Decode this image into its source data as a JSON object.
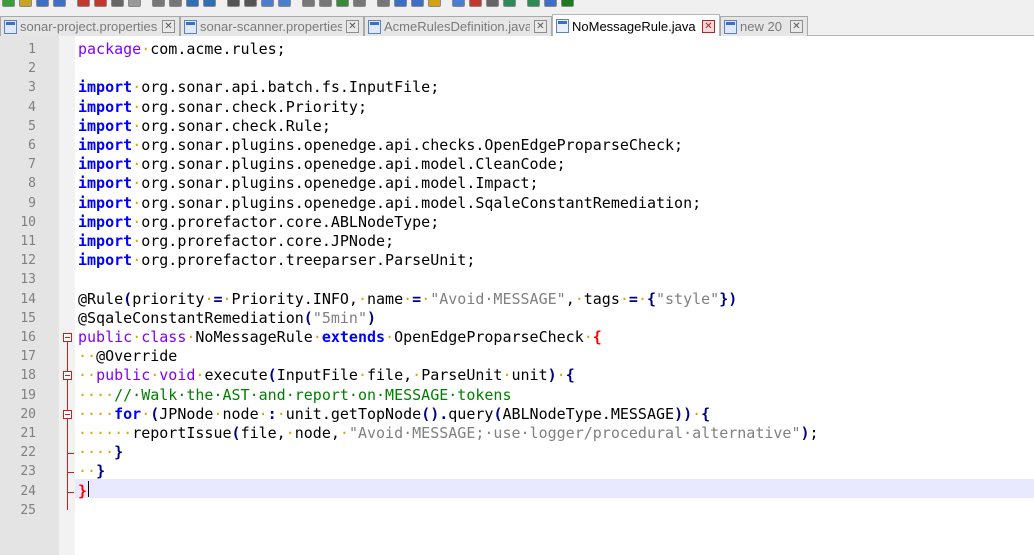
{
  "toolbar": {
    "icons": [
      "new-file-icon",
      "open-file-icon",
      "save-icon",
      "save-all-icon",
      "close-icon",
      "close-all-icon",
      "print-icon",
      "cut-icon",
      "copy-icon",
      "paste-icon",
      "undo-icon",
      "redo-icon",
      "find-icon",
      "replace-icon",
      "zoom-in-icon",
      "zoom-out-icon",
      "sync-icon",
      "wrap-icon",
      "indent-guide-icon",
      "show-all-chars-icon",
      "fold-all-icon",
      "doc-map-icon",
      "function-list-icon",
      "folder-icon",
      "monitor-icon",
      "record-macro-icon",
      "stop-macro-icon",
      "play-macro-icon",
      "run-macro-icon",
      "save-macro-icon",
      "spellcheck-icon"
    ]
  },
  "tabs": [
    {
      "label": "sonar-project.properties",
      "active": false
    },
    {
      "label": "sonar-scanner.properties",
      "active": false
    },
    {
      "label": "AcmeRulesDefinition.java",
      "active": false
    },
    {
      "label": "NoMessageRule.java",
      "active": true
    },
    {
      "label": "new 20",
      "active": false
    }
  ],
  "editor": {
    "line_numbers": [
      "1",
      "2",
      "3",
      "4",
      "5",
      "6",
      "7",
      "8",
      "9",
      "10",
      "11",
      "12",
      "13",
      "14",
      "15",
      "16",
      "17",
      "18",
      "19",
      "20",
      "21",
      "22",
      "23",
      "24",
      "25"
    ],
    "lines": [
      [
        [
          "kw2",
          "package"
        ],
        [
          "ws",
          "·"
        ],
        [
          "",
          "com.acme.rules;"
        ]
      ],
      [],
      [
        [
          "kw",
          "import"
        ],
        [
          "ws",
          "·"
        ],
        [
          "",
          "org.sonar.api.batch.fs.InputFile;"
        ]
      ],
      [
        [
          "kw",
          "import"
        ],
        [
          "ws",
          "·"
        ],
        [
          "",
          "org.sonar.check.Priority;"
        ]
      ],
      [
        [
          "kw",
          "import"
        ],
        [
          "ws",
          "·"
        ],
        [
          "",
          "org.sonar.check.Rule;"
        ]
      ],
      [
        [
          "kw",
          "import"
        ],
        [
          "ws",
          "·"
        ],
        [
          "",
          "org.sonar.plugins.openedge.api.checks.OpenEdgeProparseCheck;"
        ]
      ],
      [
        [
          "kw",
          "import"
        ],
        [
          "ws",
          "·"
        ],
        [
          "",
          "org.sonar.plugins.openedge.api.model.CleanCode;"
        ]
      ],
      [
        [
          "kw",
          "import"
        ],
        [
          "ws",
          "·"
        ],
        [
          "",
          "org.sonar.plugins.openedge.api.model.Impact;"
        ]
      ],
      [
        [
          "kw",
          "import"
        ],
        [
          "ws",
          "·"
        ],
        [
          "",
          "org.sonar.plugins.openedge.api.model.SqaleConstantRemediation;"
        ]
      ],
      [
        [
          "kw",
          "import"
        ],
        [
          "ws",
          "·"
        ],
        [
          "",
          "org.prorefactor.core.ABLNodeType;"
        ]
      ],
      [
        [
          "kw",
          "import"
        ],
        [
          "ws",
          "·"
        ],
        [
          "",
          "org.prorefactor.core.JPNode;"
        ]
      ],
      [
        [
          "kw",
          "import"
        ],
        [
          "ws",
          "·"
        ],
        [
          "",
          "org.prorefactor.treeparser.ParseUnit;"
        ]
      ],
      [],
      [
        [
          "",
          "@Rule"
        ],
        [
          "op",
          "("
        ],
        [
          "",
          "priority"
        ],
        [
          "ws",
          "·"
        ],
        [
          "op",
          "="
        ],
        [
          "ws",
          "·"
        ],
        [
          "",
          "Priority.INFO,"
        ],
        [
          "ws",
          "·"
        ],
        [
          "",
          "name"
        ],
        [
          "ws",
          "·"
        ],
        [
          "op",
          "="
        ],
        [
          "ws",
          "·"
        ],
        [
          "str",
          "\"Avoid·MESSAGE\""
        ],
        [
          "",
          ","
        ],
        [
          "ws",
          "·"
        ],
        [
          "",
          "tags"
        ],
        [
          "ws",
          "·"
        ],
        [
          "op",
          "="
        ],
        [
          "ws",
          "·"
        ],
        [
          "op",
          "{"
        ],
        [
          "str",
          "\"style\""
        ],
        [
          "op",
          "})"
        ]
      ],
      [
        [
          "",
          "@SqaleConstantRemediation"
        ],
        [
          "op",
          "("
        ],
        [
          "str",
          "\"5min\""
        ],
        [
          "op",
          ")"
        ]
      ],
      [
        [
          "kw2",
          "public"
        ],
        [
          "ws",
          "·"
        ],
        [
          "kw2",
          "class"
        ],
        [
          "ws",
          "·"
        ],
        [
          "",
          "NoMessageRule"
        ],
        [
          "ws",
          "·"
        ],
        [
          "kw",
          "extends"
        ],
        [
          "ws",
          "·"
        ],
        [
          "",
          "OpenEdgeProparseCheck"
        ],
        [
          "ws",
          "·"
        ],
        [
          "red",
          "{"
        ]
      ],
      [
        [
          "ws",
          "··"
        ],
        [
          "",
          "@Override"
        ]
      ],
      [
        [
          "ws",
          "··"
        ],
        [
          "kw2",
          "public"
        ],
        [
          "ws",
          "·"
        ],
        [
          "kw2",
          "void"
        ],
        [
          "ws",
          "·"
        ],
        [
          "",
          "execute"
        ],
        [
          "op",
          "("
        ],
        [
          "",
          "InputFile"
        ],
        [
          "ws",
          "·"
        ],
        [
          "",
          "file,"
        ],
        [
          "ws",
          "·"
        ],
        [
          "",
          "ParseUnit"
        ],
        [
          "ws",
          "·"
        ],
        [
          "",
          "unit"
        ],
        [
          "op",
          ")"
        ],
        [
          "ws",
          "·"
        ],
        [
          "op",
          "{"
        ]
      ],
      [
        [
          "ws",
          "····"
        ],
        [
          "cmt",
          "//·Walk·the·AST·and·report·on·MESSAGE·tokens"
        ]
      ],
      [
        [
          "ws",
          "····"
        ],
        [
          "kw",
          "for"
        ],
        [
          "ws",
          "·"
        ],
        [
          "op",
          "("
        ],
        [
          "",
          "JPNode"
        ],
        [
          "ws",
          "·"
        ],
        [
          "",
          "node"
        ],
        [
          "ws",
          "·"
        ],
        [
          "op",
          ":"
        ],
        [
          "ws",
          "·"
        ],
        [
          "",
          "unit.getTopNode"
        ],
        [
          "op",
          "()."
        ],
        [
          "",
          "query"
        ],
        [
          "op",
          "("
        ],
        [
          "",
          "ABLNodeType.MESSAGE"
        ],
        [
          "op",
          "))"
        ],
        [
          "ws",
          "·"
        ],
        [
          "op",
          "{"
        ]
      ],
      [
        [
          "ws",
          "······"
        ],
        [
          "",
          "reportIssue"
        ],
        [
          "op",
          "("
        ],
        [
          "",
          "file,"
        ],
        [
          "ws",
          "·"
        ],
        [
          "",
          "node,"
        ],
        [
          "ws",
          "·"
        ],
        [
          "str",
          "\"Avoid·MESSAGE;·use·logger/procedural·alternative\""
        ],
        [
          "op",
          ")"
        ],
        [
          "",
          ";"
        ]
      ],
      [
        [
          "ws",
          "····"
        ],
        [
          "op",
          "}"
        ]
      ],
      [
        [
          "ws",
          "··"
        ],
        [
          "op",
          "}"
        ]
      ],
      [
        [
          "red",
          "}"
        ]
      ],
      []
    ]
  }
}
